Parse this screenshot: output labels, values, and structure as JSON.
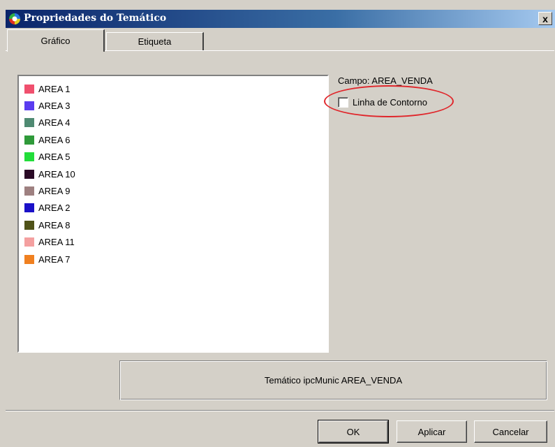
{
  "window": {
    "title": "Propriedades do Temático",
    "close_glyph": "x"
  },
  "tabs": [
    {
      "label": "Gráfico",
      "active": true
    },
    {
      "label": "Etiqueta",
      "active": false
    }
  ],
  "legend": {
    "items": [
      {
        "label": "AREA 1",
        "color": "#f0506e"
      },
      {
        "label": "AREA 3",
        "color": "#5a3cf0"
      },
      {
        "label": "AREA 4",
        "color": "#4f8a72"
      },
      {
        "label": "AREA 6",
        "color": "#2f9a3a"
      },
      {
        "label": "AREA 5",
        "color": "#22dd3a"
      },
      {
        "label": "AREA 10",
        "color": "#2a0a26"
      },
      {
        "label": "AREA 9",
        "color": "#9e8080"
      },
      {
        "label": "AREA 2",
        "color": "#1a10c8"
      },
      {
        "label": "AREA 8",
        "color": "#4f5218"
      },
      {
        "label": "AREA 11",
        "color": "#f4a0a0"
      },
      {
        "label": "AREA 7",
        "color": "#f08020"
      }
    ]
  },
  "field": {
    "label": "Campo: AREA_VENDA"
  },
  "contour": {
    "label": "Linha de Contorno",
    "checked": false,
    "highlight_color": "#e0262b"
  },
  "info": {
    "text": "Temático ipcMunic AREA_VENDA"
  },
  "buttons": {
    "ok": "OK",
    "apply": "Aplicar",
    "cancel": "Cancelar"
  },
  "colors": {
    "title_bar_start": "#0a246a",
    "title_bar_end": "#a6caf0",
    "face": "#d4d0c8"
  }
}
